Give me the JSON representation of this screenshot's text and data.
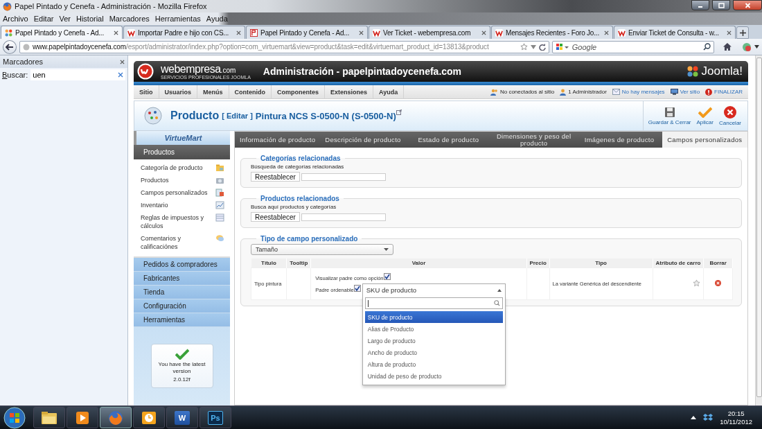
{
  "window": {
    "title": "Papel Pintado y Cenefa - Administración - Mozilla Firefox"
  },
  "menu": [
    "Archivo",
    "Editar",
    "Ver",
    "Historial",
    "Marcadores",
    "Herramientas",
    "Ayuda"
  ],
  "tabs": [
    {
      "label": "Papel Pintado y Cenefa - Ad...",
      "selected": true,
      "kind": "joomla"
    },
    {
      "label": "Importar Padre e hijo con CS...",
      "selected": false,
      "kind": "webempresa"
    },
    {
      "label": "Papel Pintado y Cenefa - Ad...",
      "selected": false,
      "kind": "page"
    },
    {
      "label": "Ver Ticket - webempresa.com",
      "selected": false,
      "kind": "webempresa"
    },
    {
      "label": "Mensajes Recientes - Foro Jo...",
      "selected": false,
      "kind": "webempresa"
    },
    {
      "label": "Enviar Ticket de Consulta - w...",
      "selected": false,
      "kind": "webempresa"
    }
  ],
  "address_bar": {
    "host": "www.papelpintadoycenefa.com",
    "path": "/esport/administrator/index.php?option=com_virtuemart&view=product&task=edit&virtuemart_product_id=13813&product",
    "search_placeholder": "Google"
  },
  "bookmarks": {
    "title": "Marcadores",
    "search_label": "Buscar:",
    "search_value": "uen"
  },
  "admin": {
    "brand": "webempresa",
    "brand_suffix": ".com",
    "brand_tagline": "SERVICIOS PROFESIONALES JOOMLA",
    "title": "Administración - papelpintadoycenefa.com",
    "cms": "Joomla!",
    "nav": [
      "Sitio",
      "Usuarios",
      "Menús",
      "Contenido",
      "Componentes",
      "Extensiones",
      "Ayuda"
    ],
    "status": [
      {
        "label": "No conectados al sitio",
        "kind": "online"
      },
      {
        "label": "1 Administrador",
        "kind": "admin"
      },
      {
        "label": "No hay mensajes",
        "kind": "messages"
      },
      {
        "label": "Ver sitio",
        "kind": "site"
      },
      {
        "label": "FINALIZAR",
        "kind": "logout"
      }
    ],
    "page_title": "Producto",
    "page_action": "[ Editar ]",
    "product": "Pintura NCS S-0500-N (S-0500-N)",
    "toolbar": [
      {
        "label": "Guardar & Cerrar",
        "kind": "save"
      },
      {
        "label": "Aplicar",
        "kind": "apply"
      },
      {
        "label": "Cancelar",
        "kind": "cancel"
      }
    ]
  },
  "sidebar": {
    "logo": "VirtueMart",
    "section": "Productos",
    "items": [
      "Categoría de producto",
      "Productos",
      "Campos personalizados",
      "Inventario",
      "Reglas de impuestos y cálculos",
      "Comentarios y calificaciónes"
    ],
    "groups": [
      "Pedidos & compradores",
      "Fabricantes",
      "Tienda",
      "Configuración",
      "Herramientas"
    ],
    "version": {
      "message": "You have the latest version",
      "number": "2.0.12f"
    }
  },
  "content_tabs": [
    {
      "label": "Información de producto",
      "selected": false
    },
    {
      "label": "Descripción de producto",
      "selected": false
    },
    {
      "label": "Estado de producto",
      "selected": false
    },
    {
      "label": "Dimensiones y peso del producto",
      "selected": false
    },
    {
      "label": "Imágenes de producto",
      "selected": false
    },
    {
      "label": "Campos personalizados",
      "selected": true
    }
  ],
  "related_categories": {
    "legend": "Categorías relacionadas",
    "label": "Búsqueda de categorías relacionadas",
    "button": "Reestablecer"
  },
  "related_products": {
    "legend": "Productos relacionados",
    "label": "Busca aquí productos y categorías",
    "button": "Reestablecer"
  },
  "custom_field": {
    "legend": "Tipo de campo personalizado",
    "select": "Tamaño",
    "columns": [
      "Título",
      "Tooltip",
      "Valor",
      "Precio",
      "Tipo",
      "Atributo de carro",
      "Borrar"
    ],
    "rows": [
      {
        "title": "Tipo pintura",
        "show_parent": {
          "label": "Visualizar padre como opción",
          "checked": true
        },
        "sortable_parent": {
          "label": "Padre ordenable",
          "checked": true
        },
        "type": "La variante Genérica del descendiente",
        "cart_attribute": false,
        "dropdown": {
          "value": "SKU de producto",
          "expanded": true,
          "options": [
            {
              "label": "SKU de producto",
              "selected": true
            },
            {
              "label": "Alias de Producto",
              "selected": false
            },
            {
              "label": "Largo de producto",
              "selected": false
            },
            {
              "label": "Ancho de producto",
              "selected": false
            },
            {
              "label": "Altura de producto",
              "selected": false
            },
            {
              "label": "Unidad de peso de producto",
              "selected": false
            }
          ]
        }
      }
    ]
  },
  "taskbar": {
    "apps": [
      {
        "kind": "explorer",
        "active": false
      },
      {
        "kind": "media",
        "active": false
      },
      {
        "kind": "firefox",
        "active": true
      },
      {
        "kind": "outlook",
        "active": false
      },
      {
        "kind": "word",
        "active": false,
        "glyph": "W"
      },
      {
        "kind": "photoshop",
        "active": false,
        "glyph": "Ps"
      }
    ],
    "clock": {
      "time": "20:15",
      "date": "10/11/2012"
    }
  }
}
